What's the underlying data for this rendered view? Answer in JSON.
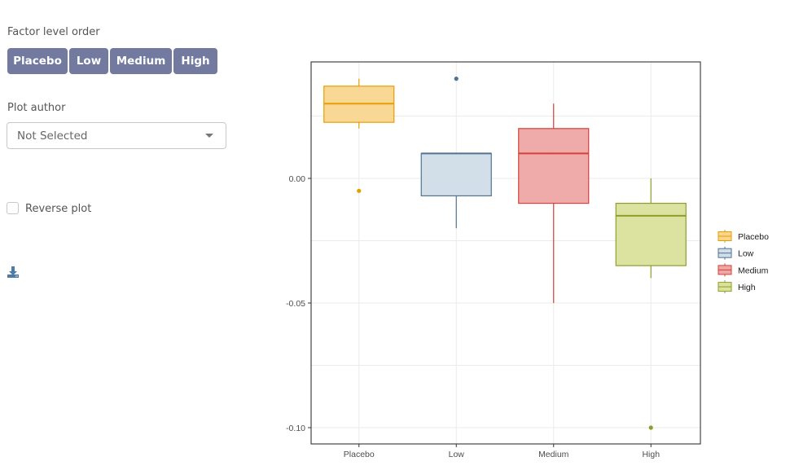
{
  "controls": {
    "factor_order_label": "Factor level order",
    "factor_buttons": [
      "Placebo",
      "Low",
      "Medium",
      "High"
    ],
    "plot_author_label": "Plot author",
    "plot_author_value": "Not Selected",
    "reverse_plot_label": "Reverse plot",
    "reverse_plot_checked": false,
    "download_icon": "download-icon"
  },
  "colors": {
    "button_bg": "#737aa0",
    "Placebo": {
      "fill": "#f9d58f",
      "stroke": "#e69f00"
    },
    "Low": {
      "fill": "#d1dde7",
      "stroke": "#4f7394"
    },
    "Medium": {
      "fill": "#eda7a4",
      "stroke": "#d6403a"
    },
    "High": {
      "fill": "#dae29b",
      "stroke": "#8f9e2a"
    }
  },
  "chart_data": {
    "type": "box",
    "title": "",
    "xlabel": "",
    "ylabel": "",
    "categories": [
      "Placebo",
      "Low",
      "Medium",
      "High"
    ],
    "ylim": [
      -0.107,
      0.047
    ],
    "yticks": [
      0.0,
      -0.05,
      -0.1
    ],
    "ytick_labels": [
      "0.00",
      "-0.05",
      "-0.10"
    ],
    "grid": true,
    "legend": {
      "position": "right",
      "entries": [
        "Placebo",
        "Low",
        "Medium",
        "High"
      ]
    },
    "boxes": [
      {
        "name": "Placebo",
        "whisker_low": 0.02,
        "q1": 0.0225,
        "median": 0.03,
        "q3": 0.037,
        "whisker_high": 0.04,
        "outliers": [
          -0.005
        ]
      },
      {
        "name": "Low",
        "whisker_low": -0.02,
        "q1": -0.007,
        "median": 0.01,
        "q3": 0.01,
        "whisker_high": 0.01,
        "outliers": [
          0.04
        ]
      },
      {
        "name": "Medium",
        "whisker_low": -0.05,
        "q1": -0.01,
        "median": 0.01,
        "q3": 0.02,
        "whisker_high": 0.03,
        "outliers": []
      },
      {
        "name": "High",
        "whisker_low": -0.04,
        "q1": -0.035,
        "median": -0.015,
        "q3": -0.01,
        "whisker_high": 0.0,
        "outliers": [
          -0.1
        ]
      }
    ]
  }
}
